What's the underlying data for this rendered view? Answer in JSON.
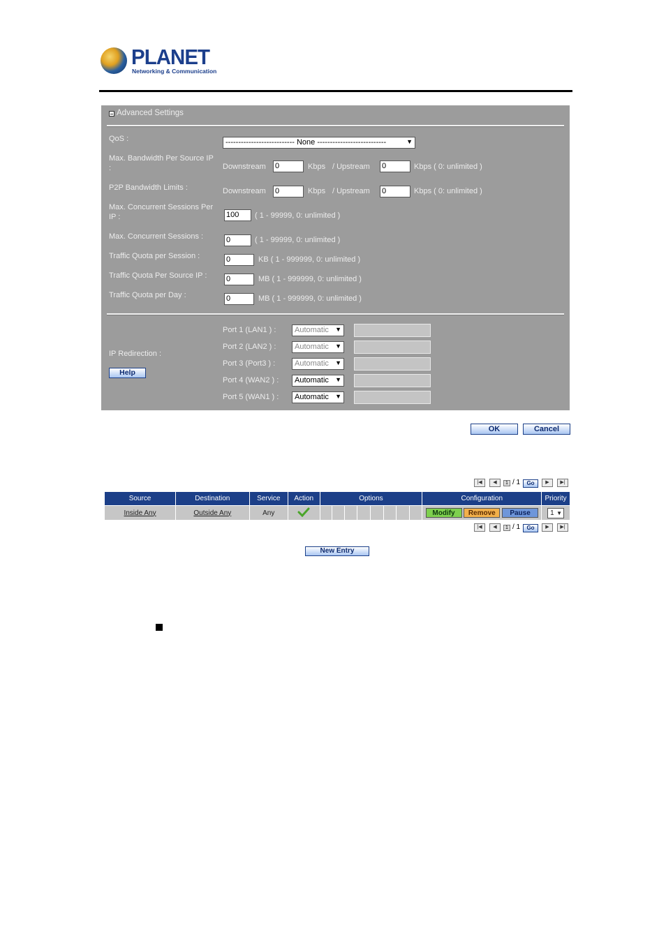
{
  "logo": {
    "name": "PLANET",
    "tagline": "Networking & Communication"
  },
  "advanced": {
    "title": "Advanced Settings",
    "qos": {
      "label": "QoS :",
      "value": "--------------------------- None ---------------------------"
    },
    "max_bw": {
      "label_line1": "Max. Bandwidth Per Source IP",
      "label_line2": ":",
      "down_label": "Downstream",
      "down_value": "0",
      "kbps1": "Kbps",
      "up_label": "/  Upstream",
      "up_value": "0",
      "hint": "Kbps ( 0: unlimited )"
    },
    "p2p": {
      "label": "P2P Bandwidth Limits :",
      "down_label": "Downstream",
      "down_value": "0",
      "kbps1": "Kbps",
      "up_label": "/  Upstream",
      "up_value": "0",
      "hint": "Kbps ( 0: unlimited )"
    },
    "sessions_per_ip": {
      "label_line1": "Max. Concurrent Sessions Per",
      "label_line2": "IP :",
      "value": "100",
      "hint": "( 1 - 99999, 0: unlimited )"
    },
    "sessions": {
      "label": "Max. Concurrent Sessions :",
      "value": "0",
      "hint": "( 1 - 99999, 0: unlimited )"
    },
    "quota_session": {
      "label": "Traffic Quota per Session :",
      "value": "0",
      "hint": "KB ( 1 - 999999, 0: unlimited )"
    },
    "quota_source": {
      "label": "Traffic Quota Per Source IP :",
      "value": "0",
      "hint": "MB ( 1 - 999999, 0: unlimited )"
    },
    "quota_day": {
      "label": "Traffic Quota per Day :",
      "value": "0",
      "hint": "MB ( 1 - 999999, 0: unlimited )"
    },
    "ip_redirection": {
      "label": "IP Redirection :",
      "help": "Help",
      "ports": [
        {
          "label": "Port 1  (LAN1 ) :",
          "mode": "Automatic",
          "enabled": false
        },
        {
          "label": "Port 2  (LAN2 ) :",
          "mode": "Automatic",
          "enabled": false
        },
        {
          "label": "Port 3  (Port3 ) :",
          "mode": "Automatic",
          "enabled": false
        },
        {
          "label": "Port 4  (WAN2 ) :",
          "mode": "Automatic",
          "enabled": true
        },
        {
          "label": "Port 5  (WAN1 ) :",
          "mode": "Automatic",
          "enabled": true
        }
      ]
    }
  },
  "buttons": {
    "ok": "OK",
    "cancel": "Cancel",
    "new_entry": "New Entry"
  },
  "pager": {
    "page": "1",
    "total": "/ 1",
    "go": "Go"
  },
  "table": {
    "headers": [
      "Source",
      "Destination",
      "Service",
      "Action",
      "Options",
      "Configuration",
      "Priority"
    ],
    "row": {
      "source": "Inside Any",
      "destination": "Outside Any",
      "service": "Any",
      "action_icon": "check-icon",
      "modify": "Modify",
      "remove": "Remove",
      "pause": "Pause",
      "priority": "1"
    }
  }
}
